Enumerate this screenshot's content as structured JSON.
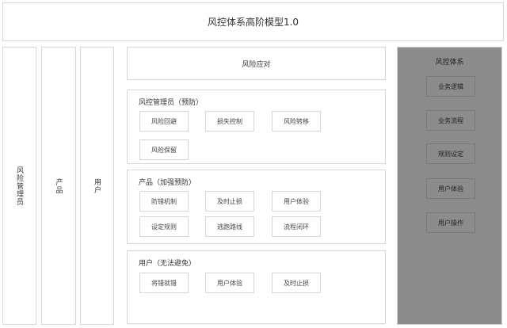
{
  "title": "风控体系高阶模型1.0",
  "columns": [
    "风险管理员",
    "产品",
    "用户"
  ],
  "response": "风险应对",
  "sections": [
    {
      "title": "风控管理员（预防）",
      "items": [
        "风险回避",
        "损失控制",
        "风险转移",
        "风险保留"
      ]
    },
    {
      "title": "产品（加强预防）",
      "items": [
        "防错机制",
        "及时止损",
        "用户体验",
        "设定规则",
        "逃跑路线",
        "流程闭环"
      ]
    },
    {
      "title": "用户（无法避免）",
      "items": [
        "将错就错",
        "用户体验",
        "及时止损"
      ]
    }
  ],
  "system": {
    "title": "风控体系",
    "items": [
      "业务逻辑",
      "业务流程",
      "规则设定",
      "用户体验",
      "用户操作"
    ]
  }
}
